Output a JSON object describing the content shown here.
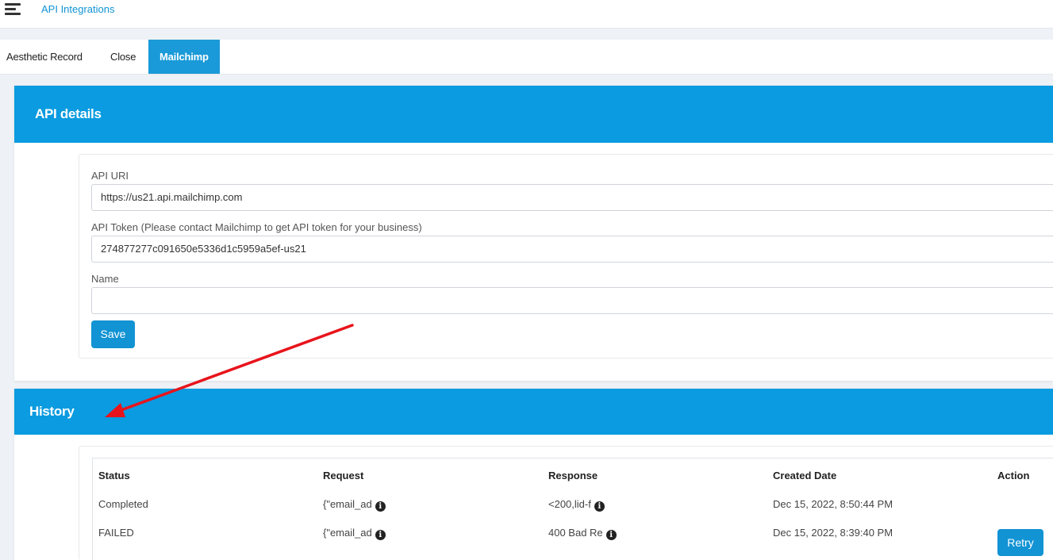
{
  "topbar": {
    "menu_icon": "hamburger-menu-icon",
    "breadcrumb": "API Integrations"
  },
  "tabs": [
    {
      "label": "Aesthetic Record",
      "active": false
    },
    {
      "label": "Close",
      "active": false
    },
    {
      "label": "Mailchimp",
      "active": true
    }
  ],
  "api_details": {
    "title": "API details",
    "fields": {
      "uri_label": "API URI",
      "uri_value": "https://us21.api.mailchimp.com",
      "token_label": "API Token (Please contact Mailchimp to get API token for your business)",
      "token_value": "274877277c091650e5336d1c5959a5ef-us21",
      "name_label": "Name",
      "name_value": ""
    },
    "save_label": "Save"
  },
  "history": {
    "title": "History",
    "columns": [
      "Status",
      "Request",
      "Response",
      "Created Date",
      "Action"
    ],
    "rows": [
      {
        "status": "Completed",
        "request": "{\"email_ad",
        "response": "<200,lid-f",
        "created": "Dec 15, 2022, 8:50:44 PM",
        "action": ""
      },
      {
        "status": "FAILED",
        "request": "{\"email_ad",
        "response": "400 Bad Re",
        "created": "Dec 15, 2022, 8:39:40 PM",
        "action": "Retry"
      }
    ],
    "info_glyph": "i"
  },
  "colors": {
    "accent": "#1193d4",
    "header_blue": "#0a9be0",
    "annotation_red": "#e8141c"
  }
}
